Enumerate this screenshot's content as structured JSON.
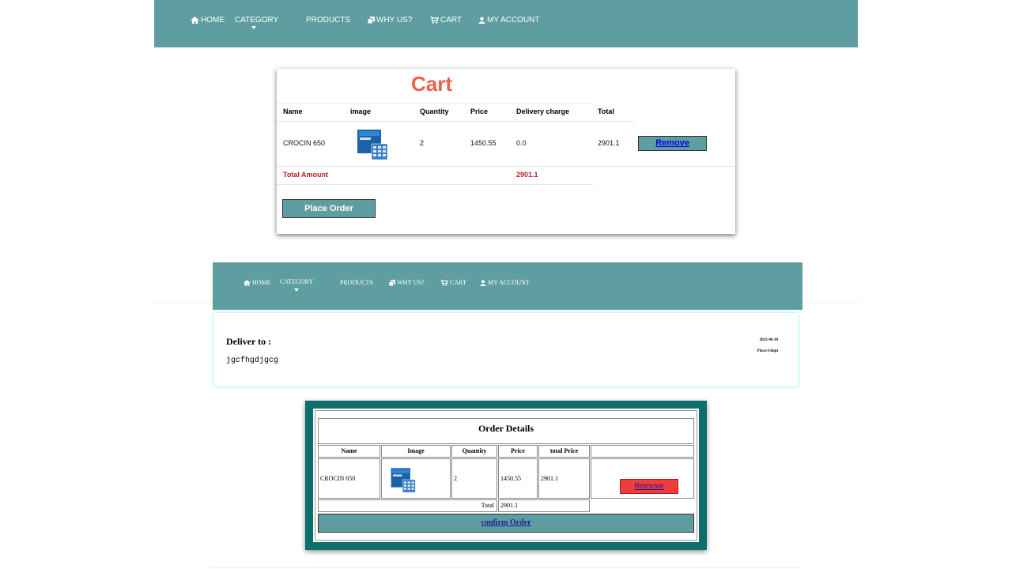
{
  "nav_top": {
    "home": "HOME",
    "category": "CATEGORY",
    "products": "PRODUCTS",
    "why_us": "WHY US?",
    "cart": "CART",
    "my_account": "MY ACCOUNT"
  },
  "cart": {
    "title": "Cart",
    "columns": [
      "Name",
      "image",
      "Quantity",
      "Price",
      "Delivery charge",
      "Total"
    ],
    "row": {
      "name": "CROCIN 650",
      "quantity": "2",
      "price": "1450.55",
      "delivery": "0.0",
      "total": "2901.1",
      "remove_label": "Remove"
    },
    "total_label": "Total Amount",
    "total_value": "2901.1",
    "place_order_label": "Place Order"
  },
  "nav_bottom": {
    "home": "HOME",
    "category": "CATEGORY",
    "products": "PRODUCTS",
    "why_us": "WHY US?",
    "cart": "CART",
    "my_account": "MY ACCOUNT"
  },
  "deliver": {
    "label": "Deliver to :",
    "address": "jgcfhgdjgcg",
    "date": "2022-06-30",
    "place": "Place:Udupi"
  },
  "order": {
    "title": "Order Details",
    "columns": [
      "Name",
      "Image",
      "Quantity",
      "Price",
      "total Price"
    ],
    "row": {
      "name": "CROCIN 650",
      "quantity": "2",
      "price": "1450.55",
      "total_price": "2901.1",
      "remove_label": "Remove"
    },
    "total_label": "Total",
    "total_value": "2901.1",
    "confirm_label": "confirm Order"
  },
  "colors": {
    "nav": "#5f9ea0",
    "cart_title": "#e8634a",
    "order_border": "#0d6e6e",
    "remove_red": "#f23c3c"
  }
}
